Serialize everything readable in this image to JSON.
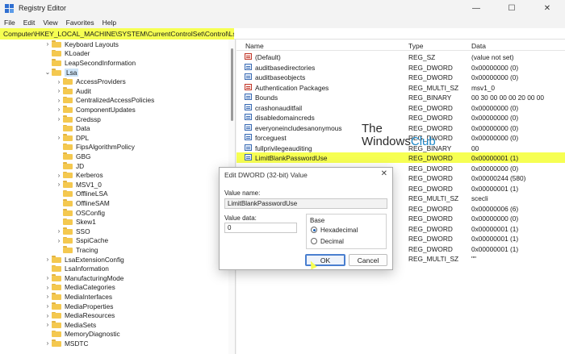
{
  "window": {
    "title": "Registry Editor",
    "controls": {
      "minimize": "—",
      "maximize": "☐",
      "close": "✕"
    }
  },
  "menu": [
    "File",
    "Edit",
    "View",
    "Favorites",
    "Help"
  ],
  "address": "Computer\\HKEY_LOCAL_MACHINE\\SYSTEM\\CurrentControlSet\\Control\\Lsa",
  "tree": [
    {
      "label": "Keyboard Layouts",
      "level": 0,
      "chevron": "›"
    },
    {
      "label": "KLoader",
      "level": 0,
      "chevron": ""
    },
    {
      "label": "LeapSecondInformation",
      "level": 0,
      "chevron": ""
    },
    {
      "label": "Lsa",
      "level": 0,
      "chevron": "⌄",
      "selected": true
    },
    {
      "label": "AccessProviders",
      "level": 1,
      "chevron": "›"
    },
    {
      "label": "Audit",
      "level": 1,
      "chevron": "›"
    },
    {
      "label": "CentralizedAccessPolicies",
      "level": 1,
      "chevron": "›"
    },
    {
      "label": "ComponentUpdates",
      "level": 1,
      "chevron": "›"
    },
    {
      "label": "Credssp",
      "level": 1,
      "chevron": "›"
    },
    {
      "label": "Data",
      "level": 1,
      "chevron": ""
    },
    {
      "label": "DPL",
      "level": 1,
      "chevron": "›"
    },
    {
      "label": "FipsAlgorithmPolicy",
      "level": 1,
      "chevron": ""
    },
    {
      "label": "GBG",
      "level": 1,
      "chevron": ""
    },
    {
      "label": "JD",
      "level": 1,
      "chevron": ""
    },
    {
      "label": "Kerberos",
      "level": 1,
      "chevron": "›"
    },
    {
      "label": "MSV1_0",
      "level": 1,
      "chevron": "›"
    },
    {
      "label": "OfflineLSA",
      "level": 1,
      "chevron": ""
    },
    {
      "label": "OfflineSAM",
      "level": 1,
      "chevron": ""
    },
    {
      "label": "OSConfig",
      "level": 1,
      "chevron": ""
    },
    {
      "label": "Skew1",
      "level": 1,
      "chevron": ""
    },
    {
      "label": "SSO",
      "level": 1,
      "chevron": "›"
    },
    {
      "label": "SspiCache",
      "level": 1,
      "chevron": "›"
    },
    {
      "label": "Tracing",
      "level": 1,
      "chevron": ""
    },
    {
      "label": "LsaExtensionConfig",
      "level": 0,
      "chevron": "›"
    },
    {
      "label": "LsaInformation",
      "level": 0,
      "chevron": ""
    },
    {
      "label": "ManufacturingMode",
      "level": 0,
      "chevron": "›"
    },
    {
      "label": "MediaCategories",
      "level": 0,
      "chevron": "›"
    },
    {
      "label": "MediaInterfaces",
      "level": 0,
      "chevron": "›"
    },
    {
      "label": "MediaProperties",
      "level": 0,
      "chevron": "›"
    },
    {
      "label": "MediaResources",
      "level": 0,
      "chevron": "›"
    },
    {
      "label": "MediaSets",
      "level": 0,
      "chevron": "›"
    },
    {
      "label": "MemoryDiagnostic",
      "level": 0,
      "chevron": ""
    },
    {
      "label": "MSDTC",
      "level": 0,
      "chevron": "›"
    }
  ],
  "columns": {
    "name": "Name",
    "type": "Type",
    "data": "Data"
  },
  "values": [
    {
      "name": "(Default)",
      "type": "REG_SZ",
      "data": "(value not set)",
      "kind": "str"
    },
    {
      "name": "auditbasedirectories",
      "type": "REG_DWORD",
      "data": "0x00000000 (0)",
      "kind": "bin"
    },
    {
      "name": "auditbaseobjects",
      "type": "REG_DWORD",
      "data": "0x00000000 (0)",
      "kind": "bin"
    },
    {
      "name": "Authentication Packages",
      "type": "REG_MULTI_SZ",
      "data": "msv1_0",
      "kind": "str"
    },
    {
      "name": "Bounds",
      "type": "REG_BINARY",
      "data": "00 30 00 00 00 20 00 00",
      "kind": "bin"
    },
    {
      "name": "crashonauditfail",
      "type": "REG_DWORD",
      "data": "0x00000000 (0)",
      "kind": "bin"
    },
    {
      "name": "disabledomaincreds",
      "type": "REG_DWORD",
      "data": "0x00000000 (0)",
      "kind": "bin"
    },
    {
      "name": "everyoneincludesanonymous",
      "type": "REG_DWORD",
      "data": "0x00000000 (0)",
      "kind": "bin"
    },
    {
      "name": "forceguest",
      "type": "REG_DWORD",
      "data": "0x00000000 (0)",
      "kind": "bin"
    },
    {
      "name": "fullprivilegeauditing",
      "type": "REG_BINARY",
      "data": "00",
      "kind": "bin"
    },
    {
      "name": "LimitBlankPasswordUse",
      "type": "REG_DWORD",
      "data": "0x00000001 (1)",
      "kind": "bin",
      "highlight": true
    },
    {
      "name": "",
      "type": "REG_DWORD",
      "data": "0x00000000 (0)",
      "kind": "bin"
    },
    {
      "name": "",
      "type": "REG_DWORD",
      "data": "0x00000244 (580)",
      "kind": "bin"
    },
    {
      "name": "",
      "type": "REG_DWORD",
      "data": "0x00000001 (1)",
      "kind": "bin"
    },
    {
      "name": "",
      "type": "REG_MULTI_SZ",
      "data": "scecli",
      "kind": "str"
    },
    {
      "name": "",
      "type": "REG_DWORD",
      "data": "0x00000006 (6)",
      "kind": "bin"
    },
    {
      "name": "",
      "type": "REG_DWORD",
      "data": "0x00000000 (0)",
      "kind": "bin"
    },
    {
      "name": "",
      "type": "REG_DWORD",
      "data": "0x00000001 (1)",
      "kind": "bin"
    },
    {
      "name": "",
      "type": "REG_DWORD",
      "data": "0x00000001 (1)",
      "kind": "bin"
    },
    {
      "name": "",
      "type": "REG_DWORD",
      "data": "0x00000001 (1)",
      "kind": "bin"
    },
    {
      "name": "",
      "type": "REG_MULTI_SZ",
      "data": "\"\"",
      "kind": "str"
    }
  ],
  "watermark": {
    "line1": "The",
    "line2a": "Windows",
    "line2b": "Club"
  },
  "dialog": {
    "title": "Edit DWORD (32-bit) Value",
    "close": "✕",
    "value_name_label": "Value name:",
    "value_name": "LimitBlankPasswordUse",
    "value_data_label": "Value data:",
    "value_data": "0",
    "base_label": "Base",
    "hex_label": "Hexadecimal",
    "dec_label": "Decimal",
    "ok": "OK",
    "cancel": "Cancel"
  },
  "colors": {
    "highlight": "#f6ff52",
    "accent": "#1a5fb4"
  }
}
